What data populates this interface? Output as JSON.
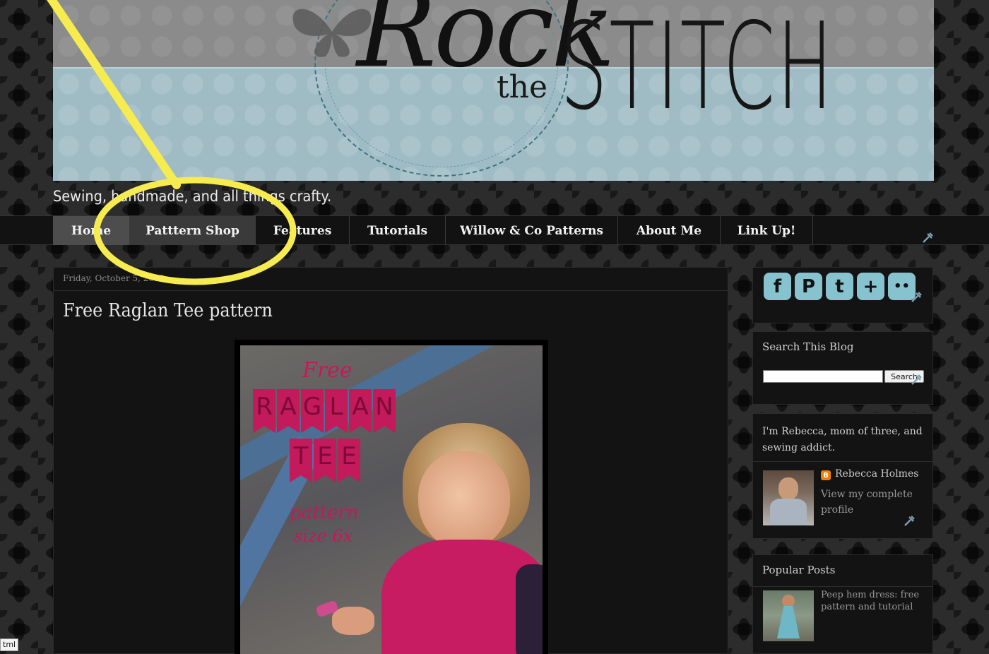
{
  "header": {
    "logo_rock": "Rock",
    "logo_the": "the",
    "logo_stitch": "STITCH",
    "tagline": "Sewing, handmade, and all things crafty."
  },
  "nav": {
    "items": [
      {
        "label": "Home"
      },
      {
        "label": "Patttern Shop"
      },
      {
        "label": "Features"
      },
      {
        "label": "Tutorials"
      },
      {
        "label": "Willow & Co Patterns"
      },
      {
        "label": "About Me"
      },
      {
        "label": "Link Up!"
      }
    ]
  },
  "post": {
    "date": "Friday, October 5, 2012",
    "title": "Free Raglan Tee pattern",
    "image_overlay": {
      "free": "Free",
      "raglan": [
        "R",
        "A",
        "G",
        "L",
        "A",
        "N"
      ],
      "tee": [
        "T",
        "E",
        "E"
      ],
      "pattern": "pattern",
      "size": "size 6x"
    }
  },
  "sidebar": {
    "social": [
      {
        "icon": "facebook-icon",
        "glyph": "f"
      },
      {
        "icon": "pinterest-icon",
        "glyph": "P"
      },
      {
        "icon": "tumblr-icon",
        "glyph": "t"
      },
      {
        "icon": "google-plus-icon",
        "glyph": "+"
      },
      {
        "icon": "flickr-icon",
        "glyph": "••"
      }
    ],
    "search": {
      "title": "Search This Blog",
      "button_label": "Search",
      "placeholder": ""
    },
    "about": {
      "text": "I'm Rebecca, mom of three, and sewing addict.",
      "profile_name": "Rebecca Holmes",
      "profile_link": "View my complete profile"
    },
    "popular": {
      "title": "Popular Posts",
      "items": [
        {
          "title": "Peep hem dress: free pattern and tutorial"
        }
      ]
    }
  },
  "status_tip": "tml",
  "colors": {
    "accent_blue": "#86c3cf",
    "highlight_yellow": "#f7ec4f",
    "title_pink": "#c21a5a"
  }
}
